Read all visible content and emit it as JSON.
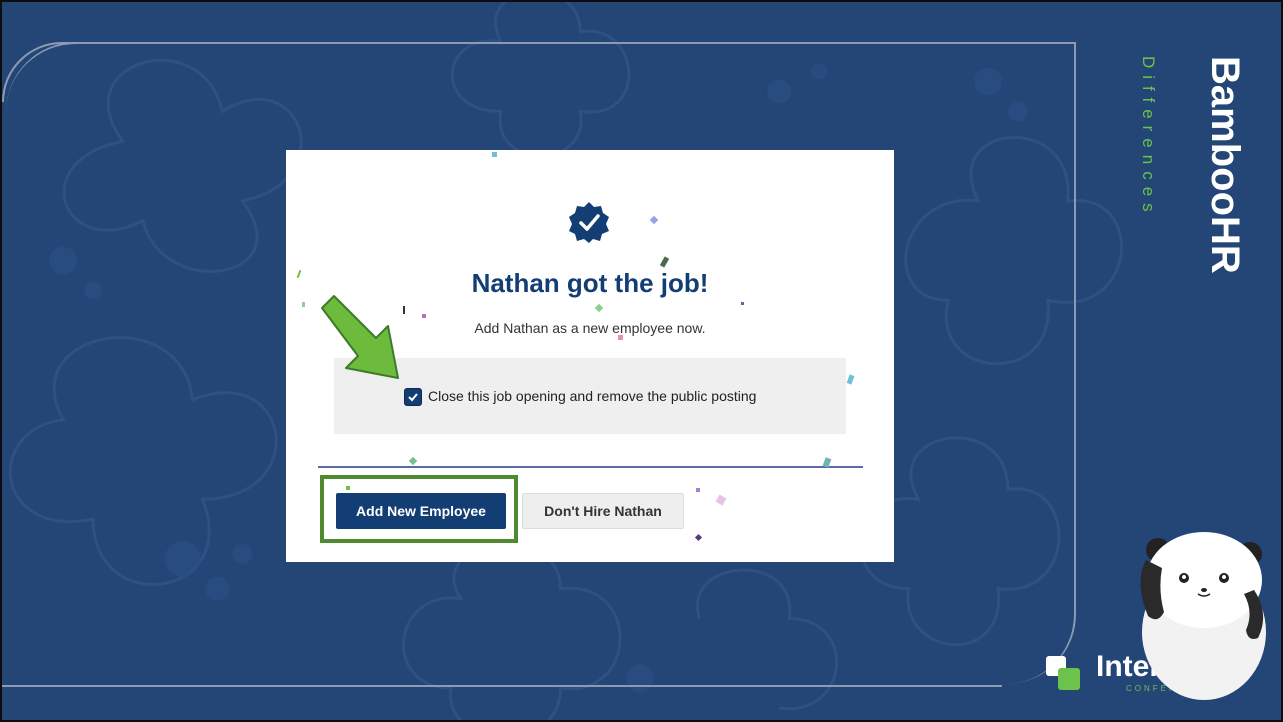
{
  "slide": {
    "title": "BambooHR",
    "subtitle": "Differences"
  },
  "dialog": {
    "headline": "Nathan got the job!",
    "subline": "Add Nathan as a new employee now.",
    "checkbox": {
      "label": "Close this job opening and remove the public posting",
      "checked": true
    },
    "primary_button": "Add New Employee",
    "secondary_button": "Don't Hire Nathan"
  },
  "logo": {
    "text": "Inter",
    "sub": "CONFERENCE"
  },
  "colors": {
    "background": "#234676",
    "navy": "#133e73",
    "green": "#6dc24b",
    "highlight": "#4f8a2e"
  },
  "icons": {
    "badge": "check-badge-icon",
    "arrow": "pointer-arrow-icon",
    "mascot": "panda-mascot-icon"
  }
}
